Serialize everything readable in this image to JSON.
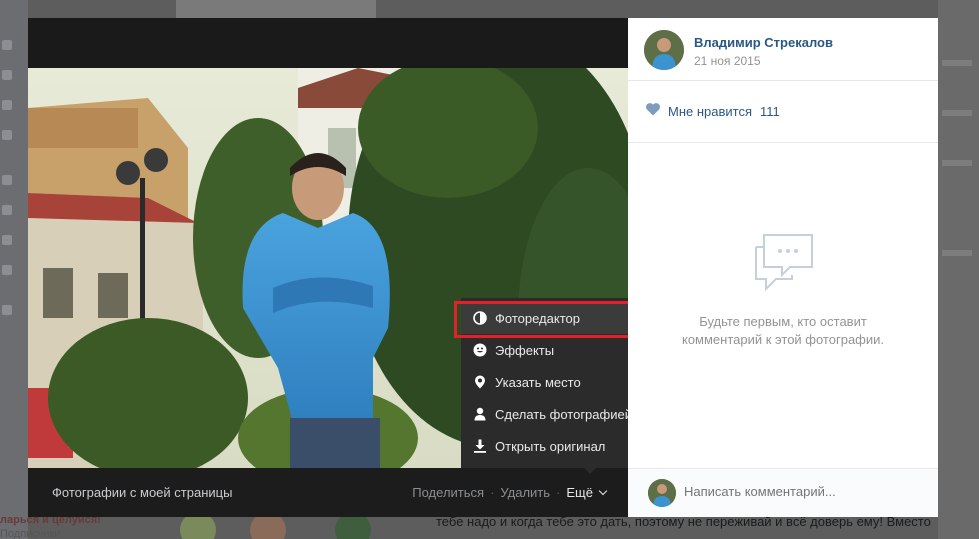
{
  "viewer": {
    "album_label": "Фотографии с моей страницы",
    "actions": {
      "share": "Поделиться",
      "delete": "Удалить",
      "more": "Ещё"
    }
  },
  "dropdown": {
    "items": [
      {
        "label": "Фоторедактор",
        "icon": "contrast-icon"
      },
      {
        "label": "Эффекты",
        "icon": "smiley-icon"
      },
      {
        "label": "Указать место",
        "icon": "location-pin-icon"
      },
      {
        "label": "Сделать фотографией профиля",
        "icon": "person-icon"
      },
      {
        "label": "Открыть оригинал",
        "icon": "download-icon"
      }
    ],
    "active_index": 0,
    "highlight_color": "#e2222a"
  },
  "panel": {
    "author_name": "Владимир Стрекалов",
    "post_date": "21 ноя 2015",
    "like_label": "Мне нравится",
    "like_count": "111",
    "no_comments_line1": "Будьте первым, кто оставит",
    "no_comments_line2": "комментарий к этой фотографии.",
    "comment_placeholder": "Написать комментарий..."
  },
  "background": {
    "bottom_text": "тебе надо и когда тебе это дать, поэтому не переживай и всё доверь ему! Вместо",
    "bottom_left_1": "ларься и целуйся!",
    "bottom_left_2": "Подписчики"
  },
  "colors": {
    "link": "#2a5885",
    "muted": "#939393",
    "menu_bg": "#2b2b2b"
  }
}
